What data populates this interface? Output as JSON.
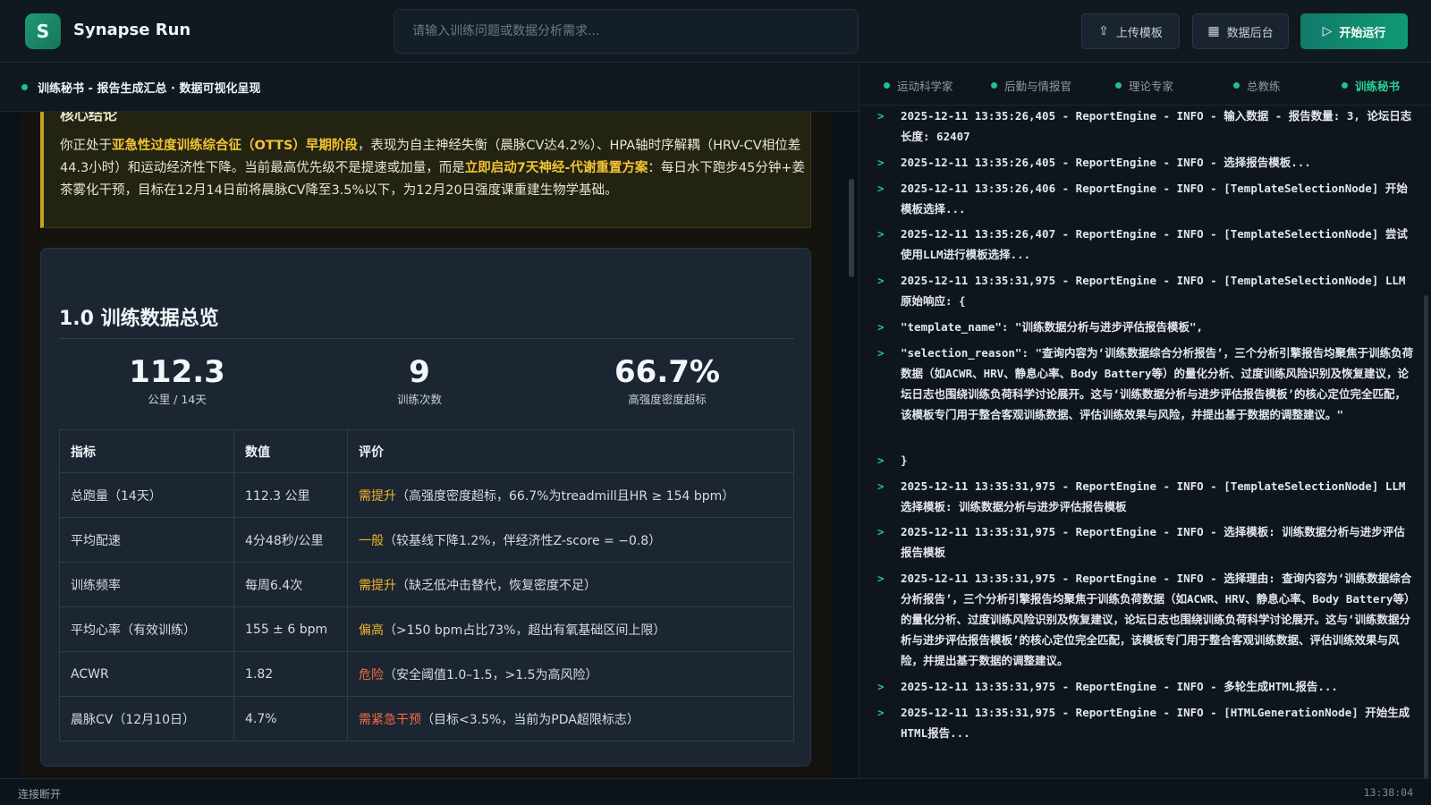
{
  "app": {
    "logo_letter": "S",
    "title": "Synapse Run"
  },
  "search": {
    "placeholder": "请输入训练问题或数据分析需求..."
  },
  "toolbar": {
    "upload_label": "上传模板",
    "data_label": "数据后台",
    "run_label": "开始运行"
  },
  "left_header": {
    "title": "训练秘书 - 报告生成汇总 · 数据可视化呈现"
  },
  "summary": {
    "cut_heading": "核心结论",
    "p1": "你正处于",
    "h1": "亚急性过度训练综合征（OTTS）早期阶段",
    "p2": "，表现为自主神经失衡（晨脉CV达4.2%）、HPA轴时序解耦（HRV-CV相位差44.3小时）和运动经济性下降。当前最高优先级不是提速或加量，而是",
    "h2": "立即启动7天神经-代谢重置方案",
    "p3": "：每日水下跑步45分钟+姜茶雾化干预，目标在12月14日前将晨脉CV降至3.5%以下，为12月20日强度课重建生物学基础。"
  },
  "overview": {
    "title": "1.0 训练数据总览",
    "stats": [
      {
        "value": "112.3",
        "label": "公里 / 14天"
      },
      {
        "value": "9",
        "label": "训练次数"
      },
      {
        "value": "66.7%",
        "label": "高强度密度超标"
      }
    ],
    "table": {
      "headers": [
        "指标",
        "数值",
        "评价"
      ],
      "rows": [
        {
          "metric": "总跑量（14天）",
          "value": "112.3 公里",
          "tag": "需提升",
          "tag_class": "warn",
          "note": "（高强度密度超标，66.7%为treadmill且HR ≥ 154 bpm）"
        },
        {
          "metric": "平均配速",
          "value": "4分48秒/公里",
          "tag": "一般",
          "tag_class": "warn",
          "note": "（较基线下降1.2%，伴经济性Z-score = −0.8）"
        },
        {
          "metric": "训练频率",
          "value": "每周6.4次",
          "tag": "需提升",
          "tag_class": "warn",
          "note": "（缺乏低冲击替代，恢复密度不足）"
        },
        {
          "metric": "平均心率（有效训练）",
          "value": "155 ± 6 bpm",
          "tag": "偏高",
          "tag_class": "warn",
          "note": "（>150 bpm占比73%，超出有氧基础区间上限）"
        },
        {
          "metric": "ACWR",
          "value": "1.82",
          "tag": "危险",
          "tag_class": "danger",
          "note": "（安全阈值1.0–1.5，>1.5为高风险）"
        },
        {
          "metric": "晨脉CV（12月10日）",
          "value": "4.7%",
          "tag": "需紧急干预",
          "tag_class": "danger",
          "note": "（目标<3.5%，当前为PDA超限标志）"
        }
      ]
    }
  },
  "tabs": [
    {
      "label": "运动科学家",
      "active": false
    },
    {
      "label": "后勤与情报官",
      "active": false
    },
    {
      "label": "理论专家",
      "active": false
    },
    {
      "label": "总教练",
      "active": false
    },
    {
      "label": "训练秘书",
      "active": true
    }
  ],
  "logs": [
    "2025-12-11 13:35:26,405 - ReportEngine - INFO - 输入数据 - 报告数量: 3, 论坛日志长度: 62407",
    "2025-12-11 13:35:26,405 - ReportEngine - INFO - 选择报告模板...",
    "2025-12-11 13:35:26,406 - ReportEngine - INFO - [TemplateSelectionNode] 开始模板选择...",
    "2025-12-11 13:35:26,407 - ReportEngine - INFO - [TemplateSelectionNode] 尝试使用LLM进行模板选择...",
    "2025-12-11 13:35:31,975 - ReportEngine - INFO - [TemplateSelectionNode] LLM原始响应: {",
    "  \"template_name\": \"训练数据分析与进步评估报告模板\",",
    "  \"selection_reason\": \"查询内容为‘训练数据综合分析报告’，三个分析引擎报告均聚焦于训练负荷数据（如ACWR、HRV、静息心率、Body Battery等）的量化分析、过度训练风险识别及恢复建议，论坛日志也围绕训练负荷科学讨论展开。这与‘训练数据分析与进步评估报告模板’的核心定位完全匹配，该模板专门用于整合客观训练数据、评估训练效果与风险，并提出基于数据的调整建议。\"",
    "}",
    "2025-12-11 13:35:31,975 - ReportEngine - INFO - [TemplateSelectionNode] LLM选择模板: 训练数据分析与进步评估报告模板",
    "2025-12-11 13:35:31,975 - ReportEngine - INFO - 选择模板: 训练数据分析与进步评估报告模板",
    "2025-12-11 13:35:31,975 - ReportEngine - INFO - 选择理由: 查询内容为‘训练数据综合分析报告’，三个分析引擎报告均聚焦于训练负荷数据（如ACWR、HRV、静息心率、Body Battery等）的量化分析、过度训练风险识别及恢复建议，论坛日志也围绕训练负荷科学讨论展开。这与‘训练数据分析与进步评估报告模板’的核心定位完全匹配，该模板专门用于整合客观训练数据、评估训练效果与风险，并提出基于数据的调整建议。",
    "2025-12-11 13:35:31,975 - ReportEngine - INFO - 多轮生成HTML报告...",
    "2025-12-11 13:35:31,975 - ReportEngine - INFO - [HTMLGenerationNode] 开始生成HTML报告..."
  ],
  "status": {
    "connection": "连接断开",
    "time": "13:38:04"
  }
}
